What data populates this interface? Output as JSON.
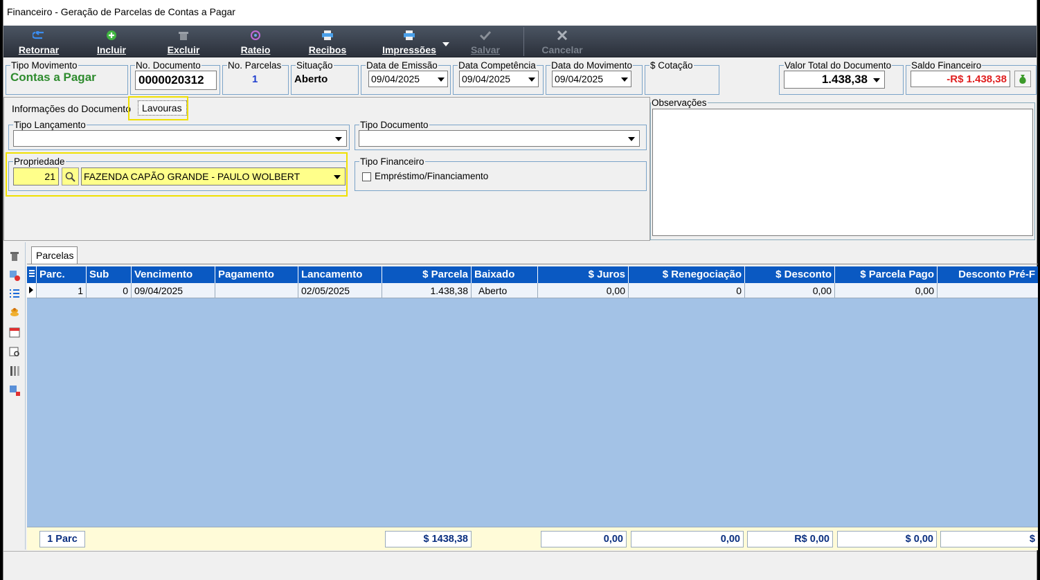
{
  "window": {
    "title": "Financeiro - Geração de Parcelas de Contas a Pagar"
  },
  "toolbar": {
    "retornar": "Retornar",
    "incluir": "Incluir",
    "excluir": "Excluir",
    "rateio": "Rateio",
    "recibos": "Recibos",
    "impressoes": "Impressões",
    "salvar": "Salvar",
    "cancelar": "Cancelar"
  },
  "header": {
    "tipo_movimento_label": "Tipo Movimento",
    "tipo_movimento_value": "Contas a Pagar",
    "no_documento_label": "No. Documento",
    "no_documento_value": "0000020312",
    "no_parcelas_label": "No. Parcelas",
    "no_parcelas_value": "1",
    "situacao_label": "Situação",
    "situacao_value": "Aberto",
    "data_emissao_label": "Data de Emissão",
    "data_emissao_value": "09/04/2025",
    "data_competencia_label": "Data Competência",
    "data_competencia_value": "09/04/2025",
    "data_movimento_label": "Data do Movimento",
    "data_movimento_value": "09/04/2025",
    "cotacao_label": "$ Cotação",
    "valor_total_label": "Valor Total do Documento",
    "valor_total_value": "1.438,38",
    "saldo_label": "Saldo Financeiro",
    "saldo_value": "-R$ 1.438,38"
  },
  "tabs": {
    "informacoes": "Informações do Documento",
    "lavouras": "Lavouras"
  },
  "form": {
    "tipo_lancamento_label": "Tipo Lançamento",
    "tipo_documento_label": "Tipo Documento",
    "propriedade_label": "Propriedade",
    "propriedade_code": "21",
    "propriedade_name": "FAZENDA CAPÃO GRANDE - PAULO WOLBERT",
    "tipo_financeiro_label": "Tipo Financeiro",
    "emprestimo_label": "Empréstimo/Financiamento",
    "observacoes_label": "Observações"
  },
  "grid": {
    "tab_label": "Parcelas",
    "columns": [
      "Parc.",
      "Sub",
      "Vencimento",
      "Pagamento",
      "Lancamento",
      "$ Parcela",
      "Baixado",
      "$ Juros",
      "$ Renegociação",
      "$ Desconto",
      "$ Parcela Pago",
      "Desconto Pré-F"
    ],
    "rows": [
      [
        "1",
        "0",
        "09/04/2025",
        "",
        "02/05/2025",
        "1.438,38",
        "Aberto",
        "0,00",
        "0",
        "0,00",
        "0,00",
        ""
      ]
    ],
    "footer": {
      "count": "1 Parc",
      "parcela_total": "$ 1438,38",
      "juros_total": "0,00",
      "reneg_total": "0,00",
      "desconto_total": "R$ 0,00",
      "pago_total": "$ 0,00",
      "last_total": "$"
    }
  }
}
